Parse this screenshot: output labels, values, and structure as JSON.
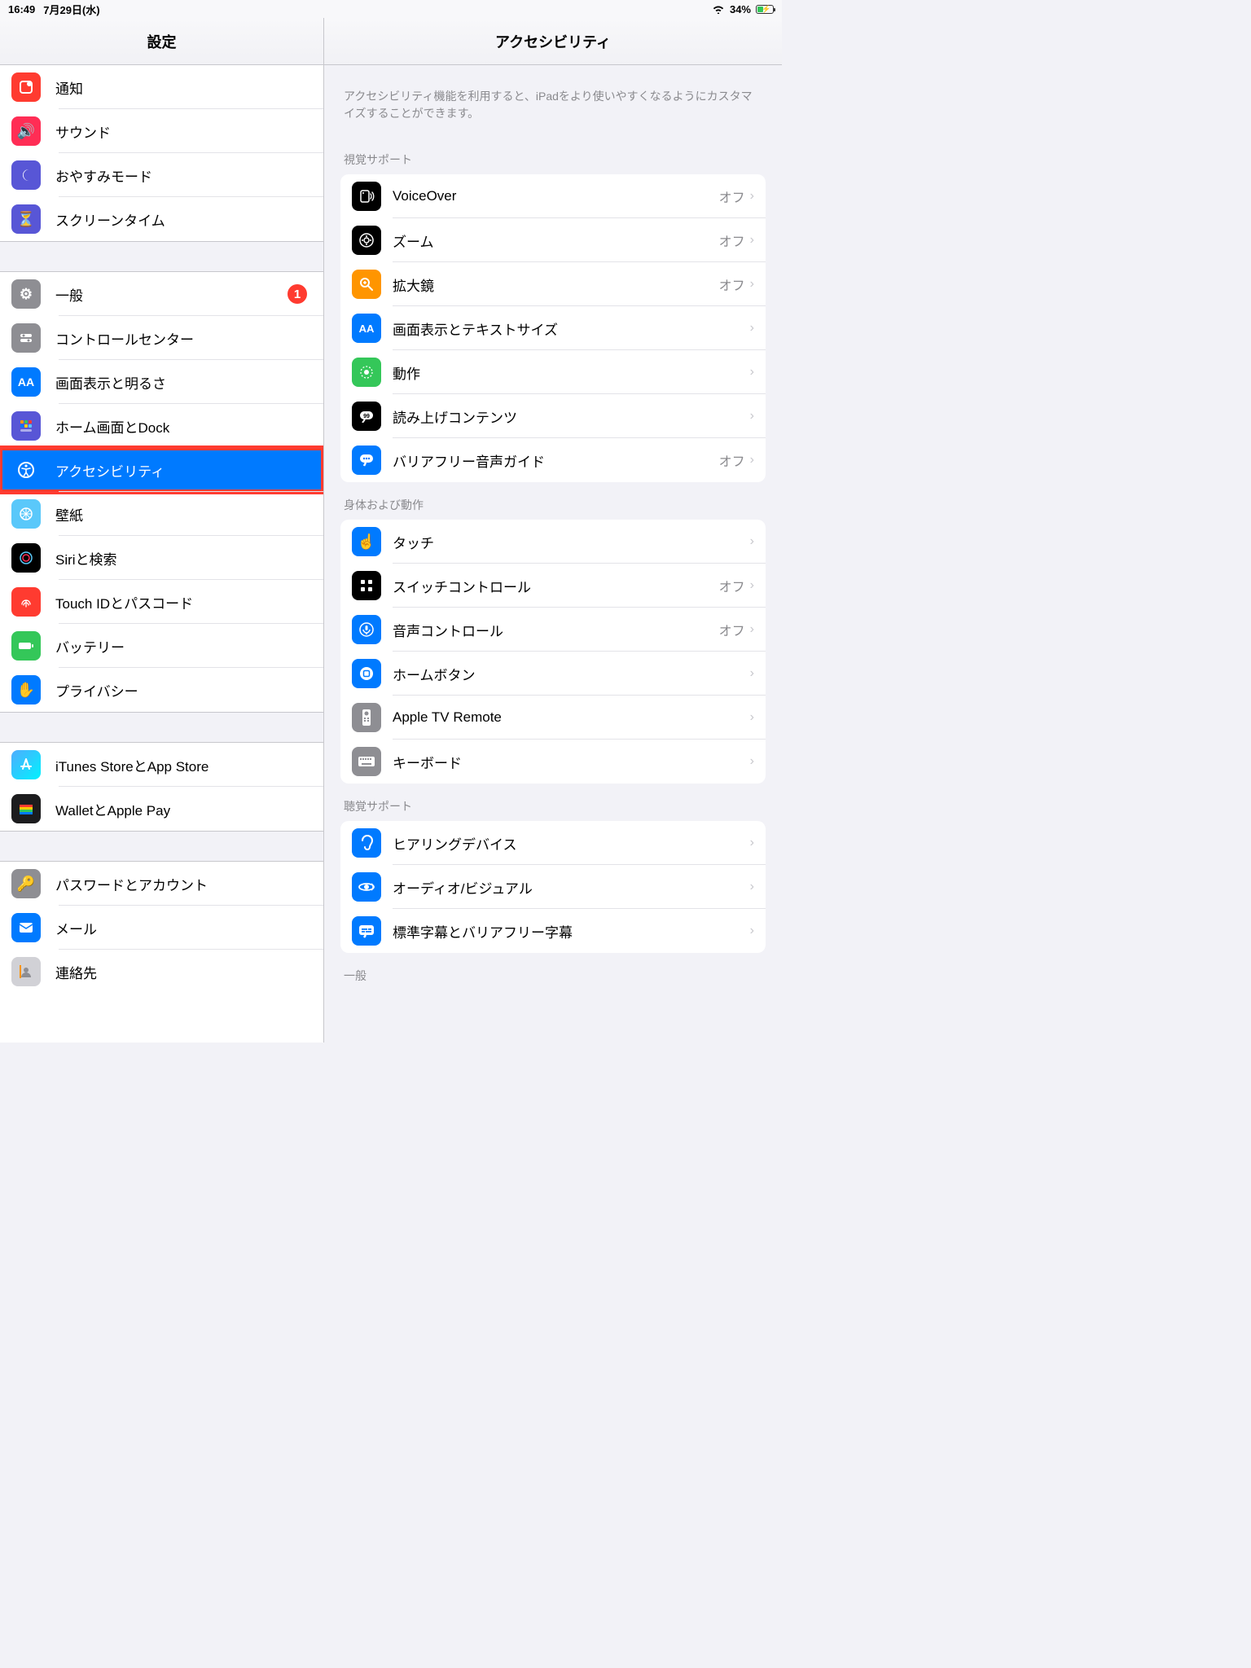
{
  "status": {
    "time": "16:49",
    "date": "7月29日(水)",
    "battery": "34%"
  },
  "sidebar": {
    "title": "設定",
    "g1": [
      {
        "label": "通知"
      },
      {
        "label": "サウンド"
      },
      {
        "label": "おやすみモード"
      },
      {
        "label": "スクリーンタイム"
      }
    ],
    "g2": [
      {
        "label": "一般",
        "badge": "1"
      },
      {
        "label": "コントロールセンター"
      },
      {
        "label": "画面表示と明るさ"
      },
      {
        "label": "ホーム画面とDock"
      },
      {
        "label": "アクセシビリティ"
      },
      {
        "label": "壁紙"
      },
      {
        "label": "Siriと検索"
      },
      {
        "label": "Touch IDとパスコード"
      },
      {
        "label": "バッテリー"
      },
      {
        "label": "プライバシー"
      }
    ],
    "g3": [
      {
        "label": "iTunes StoreとApp Store"
      },
      {
        "label": "WalletとApple Pay"
      }
    ],
    "g4": [
      {
        "label": "パスワードとアカウント"
      },
      {
        "label": "メール"
      },
      {
        "label": "連絡先"
      }
    ]
  },
  "detail": {
    "title": "アクセシビリティ",
    "intro": "アクセシビリティ機能を利用すると、iPadをより使いやすくなるようにカスタマイズすることができます。",
    "off": "オフ",
    "s1h": "視覚サポート",
    "s1": [
      {
        "label": "VoiceOver",
        "value": "オフ"
      },
      {
        "label": "ズーム",
        "value": "オフ"
      },
      {
        "label": "拡大鏡",
        "value": "オフ"
      },
      {
        "label": "画面表示とテキストサイズ"
      },
      {
        "label": "動作"
      },
      {
        "label": "読み上げコンテンツ"
      },
      {
        "label": "バリアフリー音声ガイド",
        "value": "オフ"
      }
    ],
    "s2h": "身体および動作",
    "s2": [
      {
        "label": "タッチ"
      },
      {
        "label": "スイッチコントロール",
        "value": "オフ"
      },
      {
        "label": "音声コントロール",
        "value": "オフ"
      },
      {
        "label": "ホームボタン"
      },
      {
        "label": "Apple TV Remote"
      },
      {
        "label": "キーボード"
      }
    ],
    "s3h": "聴覚サポート",
    "s3": [
      {
        "label": "ヒアリングデバイス"
      },
      {
        "label": "オーディオ/ビジュアル"
      },
      {
        "label": "標準字幕とバリアフリー字幕"
      }
    ],
    "s4h": "一般"
  }
}
